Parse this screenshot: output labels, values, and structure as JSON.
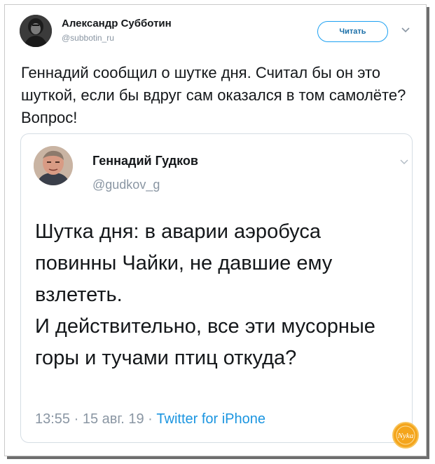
{
  "tweet": {
    "author_name": "Александр Субботин",
    "author_handle": "@subbotin_ru",
    "follow_label": "Читать",
    "text": "Геннадий сообщил о шутке дня. Считал бы он это шуткой, если бы вдруг сам оказался в том самолёте? Вопрос!"
  },
  "quote": {
    "author_name": "Геннадий Гудков",
    "author_handle": "@gudkov_g",
    "paragraph_1": "Шутка дня: в аварии аэробуса повинны Чайки, не давшие ему взлететь.",
    "paragraph_2": "И действительно, все эти мусорные горы и тучами птиц откуда?",
    "time": "13:55",
    "separator": " · ",
    "date": "15 авг. 19",
    "source": "Twitter for iPhone"
  },
  "watermark": {
    "text": "Nyka"
  },
  "colors": {
    "accent": "#1da1f2",
    "text": "#14171a",
    "muted": "#8a96a3"
  }
}
